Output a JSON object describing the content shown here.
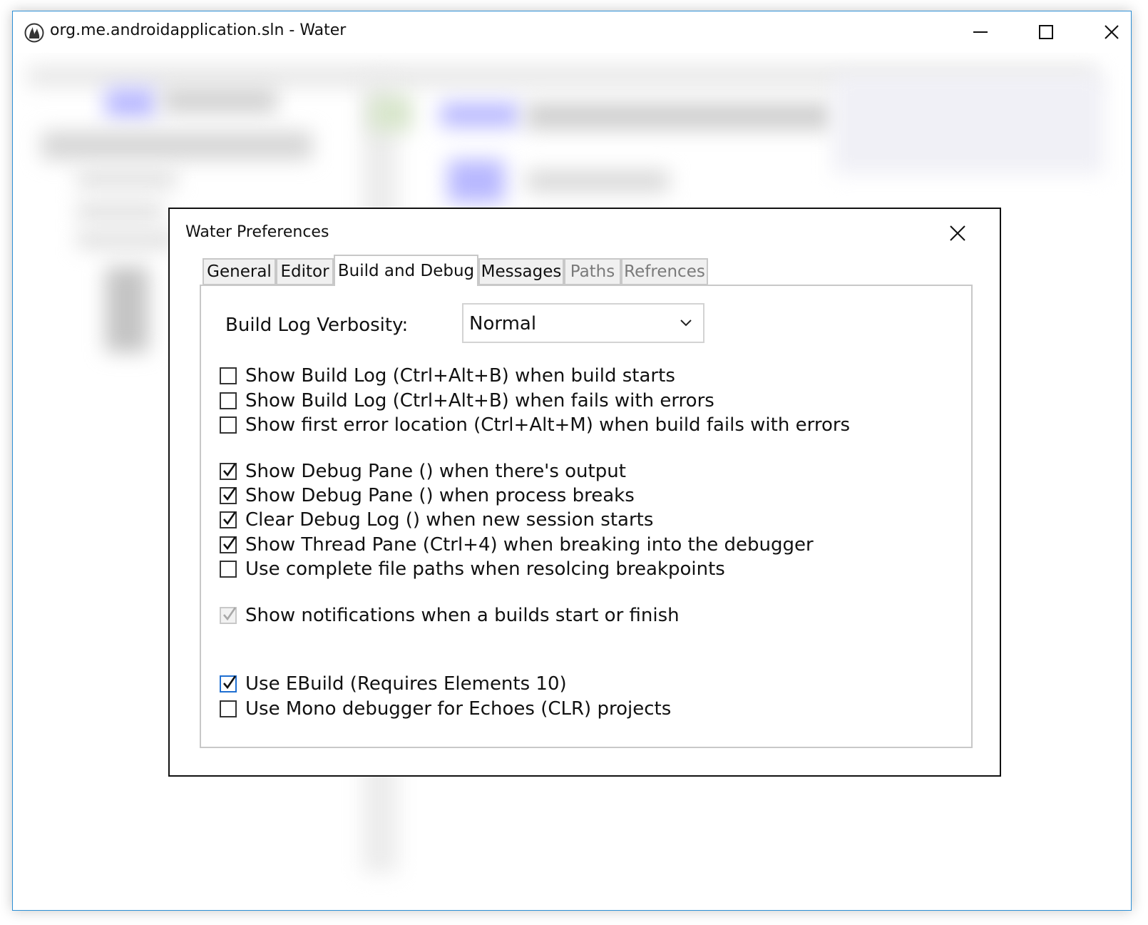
{
  "window": {
    "title": "org.me.androidapplication.sln - Water",
    "minimize_label": "Minimize",
    "maximize_label": "Maximize",
    "close_label": "Close",
    "icon": "water-app-icon"
  },
  "dialog": {
    "title": "Water Preferences",
    "close_icon": "close-icon",
    "tabs": [
      {
        "label": "General",
        "state": "normal"
      },
      {
        "label": "Editor",
        "state": "normal"
      },
      {
        "label": "Build and Debug",
        "state": "active"
      },
      {
        "label": "Messages",
        "state": "normal"
      },
      {
        "label": "Paths",
        "state": "disabled"
      },
      {
        "label": "Refrences",
        "state": "disabled"
      }
    ],
    "build_log_verbosity": {
      "label": "Build Log Verbosity:",
      "value": "Normal"
    },
    "options": [
      {
        "label": "Show Build Log (Ctrl+Alt+B) when build starts",
        "checked": false
      },
      {
        "label": "Show Build Log (Ctrl+Alt+B) when fails with errors",
        "checked": false
      },
      {
        "label": "Show first error location (Ctrl+Alt+M) when build fails with errors",
        "checked": false
      },
      {
        "label": "Show Debug Pane () when there's output",
        "checked": true
      },
      {
        "label": "Show Debug Pane () when process breaks",
        "checked": true
      },
      {
        "label": "Clear Debug Log () when new session starts",
        "checked": true
      },
      {
        "label": "Show Thread Pane (Ctrl+4) when breaking into the debugger",
        "checked": true
      },
      {
        "label": "Use complete file paths when resolcing breakpoints",
        "checked": false
      },
      {
        "label": "Show notifications when a builds start or finish",
        "checked": true,
        "disabled": true
      },
      {
        "label": "Use EBuild (Requires Elements 10)",
        "checked": true,
        "focused": true
      },
      {
        "label": "Use Mono debugger for Echoes (CLR) projects",
        "checked": false
      }
    ]
  },
  "colors": {
    "window_border": "#2d8fd5",
    "focus_accent": "#1f6fd1",
    "tab_border": "#c8c8c8"
  }
}
